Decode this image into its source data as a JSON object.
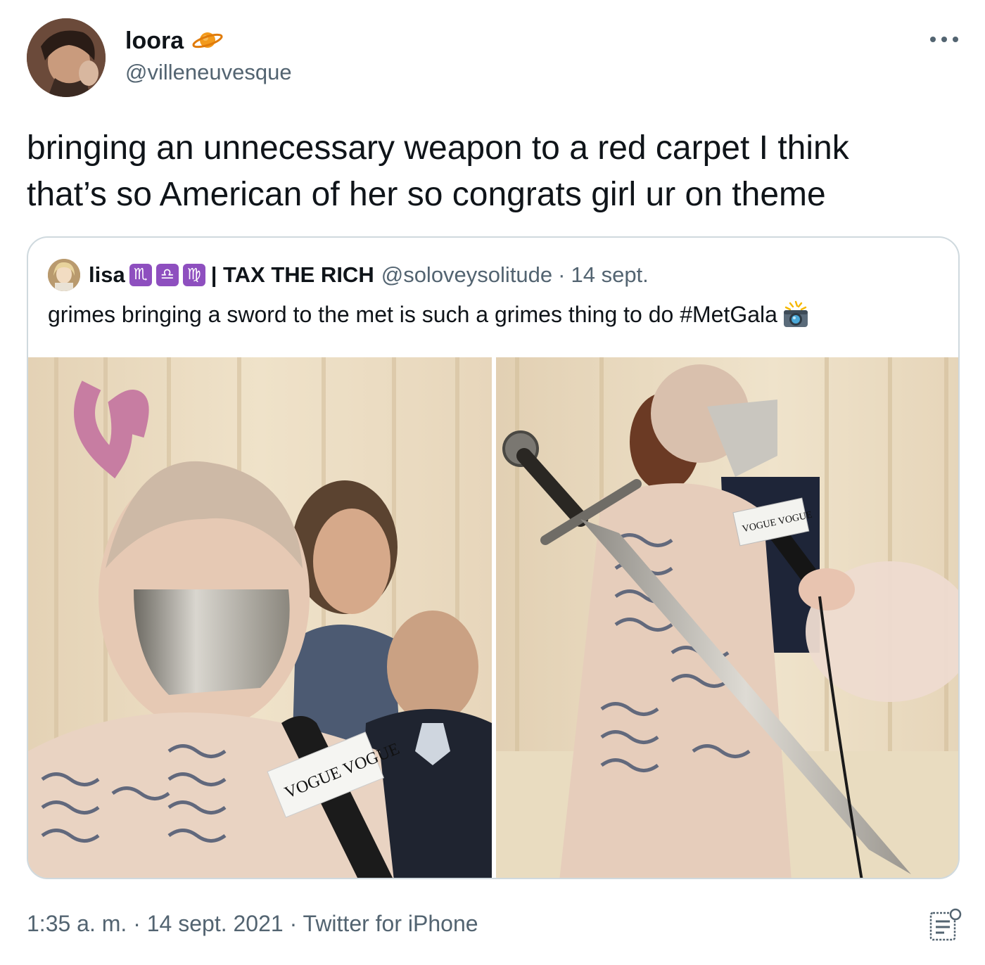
{
  "author": {
    "display_name": "loora",
    "handle": "@villeneuvesque",
    "badge_icon": "ringed-planet-icon",
    "avatar_icon": "profile-photo"
  },
  "tweet": {
    "text": "bringing an unnecessary weapon to a red carpet I think\nthat’s so American of her so congrats girl ur on theme"
  },
  "quoted_tweet": {
    "display_name": "lisa",
    "zodiac_badges": [
      "♏",
      "♎",
      "♍"
    ],
    "name_suffix": "| TAX THE RICH",
    "handle": "@soloveysolitude",
    "separator": "·",
    "date": "14 sept.",
    "text": "grimes bringing a sword to the met is such a grimes thing to do #MetGala",
    "emoji_icon": "camera-with-flash-icon",
    "photos": [
      {
        "name": "photo-grimes-interview",
        "mic_flag": "VOGUE VOGUE"
      },
      {
        "name": "photo-grimes-sword",
        "mic_flag": "VOGUE VOGUE"
      }
    ]
  },
  "footer": {
    "time": "1:35 a. m.",
    "sep1": "·",
    "date": "14 sept. 2021",
    "sep2": "·",
    "source": "Twitter for iPhone",
    "analytics_icon": "analytics-icon"
  },
  "colors": {
    "text_primary": "#0f1419",
    "text_secondary": "#536471",
    "border": "#cfd9de",
    "zodiac_badge": "#8e4fbf"
  }
}
